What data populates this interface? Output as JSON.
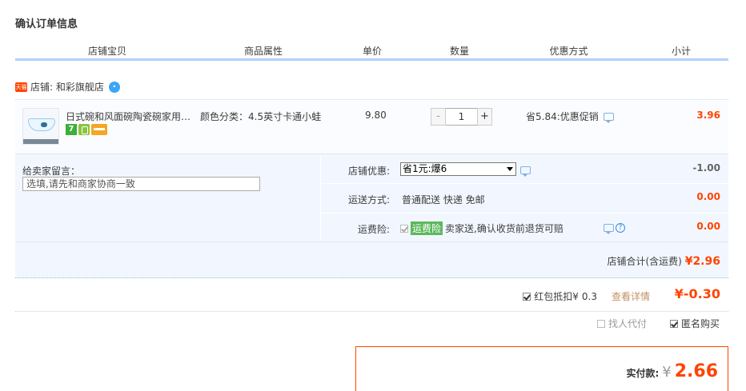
{
  "page_title": "确认订单信息",
  "table_headers": [
    "店铺宝贝",
    "商品属性",
    "单价",
    "数量",
    "优惠方式",
    "小计"
  ],
  "shop": {
    "badge": "天猫",
    "label": "店铺: 和彩旗舰店",
    "ww_icon": "wangwang-icon"
  },
  "item": {
    "name": "日式碗和风面碗陶瓷碗家用…",
    "attribute": "颜色分类：4.5英寸卡通小蛙",
    "price": "9.80",
    "quantity": "1",
    "minus": "-",
    "plus": "+",
    "discount": "省5.84:优惠促销",
    "subtotal": "3.96",
    "badge_seven": "7"
  },
  "options": {
    "message_label": "给卖家留言：",
    "message_placeholder": "选填,请先和商家协商一致",
    "shop_discount_label": "店铺优惠:",
    "shop_discount_value": "省1元:爆6",
    "shop_discount_amount": "-1.00",
    "shipping_label": "运送方式:",
    "shipping_value": "普通配送 快递 免邮",
    "shipping_amount": "0.00",
    "insurance_label": "运费险:",
    "insurance_tag": "运费险",
    "insurance_text": "卖家送,确认收货前退货可赔",
    "insurance_amount": "0.00",
    "question_mark": "?"
  },
  "total": {
    "label": "店铺合计(含运费)",
    "amount": "¥2.96"
  },
  "redpack": {
    "label": "红包抵扣¥",
    "value": "0.3",
    "link": "查看详情",
    "amount": "¥-0.30"
  },
  "extras": {
    "proxy_pay": "找人代付",
    "anonymous": "匿名购买"
  },
  "payment": {
    "label": "实付款:",
    "currency": "¥",
    "amount": "2.66"
  },
  "colors": {
    "accent": "#ff4400",
    "header_border": "#b2d1ff",
    "row_bg": "#f2f7ff"
  }
}
